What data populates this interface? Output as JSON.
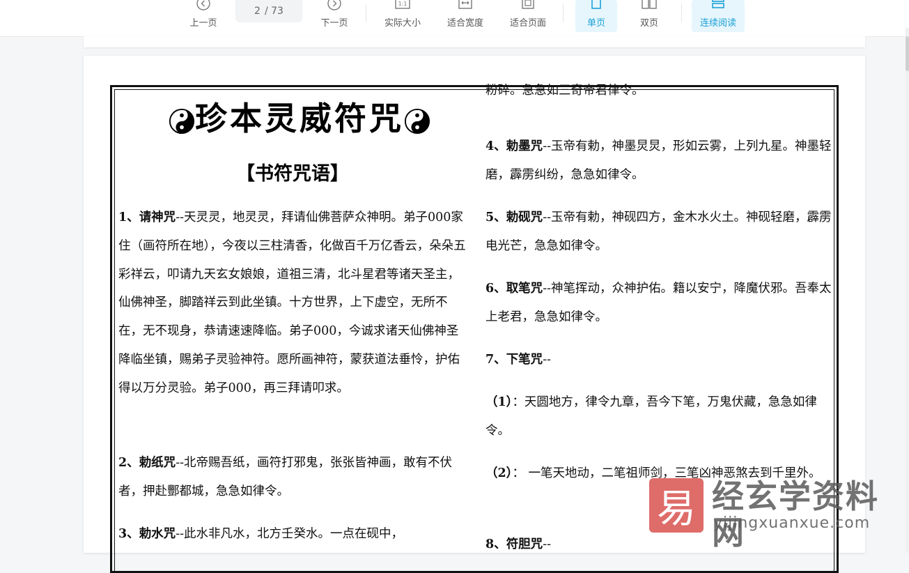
{
  "toolbar": {
    "prev_label": "上一页",
    "page_current": "2",
    "page_total": "/ 73",
    "next_label": "下一页",
    "actual_size_label": "实际大小",
    "fit_width_label": "适合宽度",
    "fit_page_label": "适合页面",
    "single_page_label": "单页",
    "double_page_label": "双页",
    "continuous_label": "连续阅读",
    "accent_color": "#1da1d8"
  },
  "document": {
    "title": "珍本灵威符咒",
    "subtitle": "【书符咒语】",
    "left_paragraphs": [
      {
        "num": "1、",
        "name": "请神咒",
        "text": "--天灵灵，地灵灵，拜请仙佛菩萨众神明。弟子000家住（画符所在地），今夜以三柱清香，化做百千万亿香云，朵朵五彩祥云，叩请九天玄女娘娘，道祖三清，北斗星君等诸天圣主，仙佛神圣，脚踏祥云到此坐镇。十方世界，上下虚空，无所不在，无不现身，恭请速速降临。弟子000，今诚求诸天仙佛神圣降临坐镇，赐弟子灵验神符。愿所画神符，蒙获道法垂怜，护佑得以万分灵验。弟子000，再三拜请叩求。"
      },
      {
        "num": "2、",
        "name": "勅纸咒",
        "text": "--北帝赐吾纸，画符打邪鬼，张张皆神画，敢有不伏者，押赴酆都城，急急如律令。"
      },
      {
        "num": "3、",
        "name": "勅水咒",
        "text": "--此水非凡水，北方壬癸水。一点在砚中，"
      }
    ],
    "right_paragraphs": [
      {
        "num": "",
        "name": "",
        "text": "粉碎。急急如三奇帝君律令。"
      },
      {
        "num": "4、",
        "name": "勅墨咒",
        "text": "--玉帝有勅，神墨炅炅，形如云雾，上列九星。神墨轻磨，霹雳纠纷，急急如律令。"
      },
      {
        "num": "5、",
        "name": "勅砚咒",
        "text": "--玉帝有勅，神砚四方，金木水火土。神砚轻磨，霹雳电光芒，急急如律令。"
      },
      {
        "num": "6、",
        "name": "取笔咒",
        "text": "--神笔挥动，众神护佑。籍以安宁，降魔伏邪。吾奉太上老君，急急如律令。"
      },
      {
        "num": "7、",
        "name": "下笔咒",
        "text": "--"
      },
      {
        "num": "（1）",
        "name": "",
        "text": "：天圆地方，律令九章，吾今下笔，万鬼伏藏，急急如律令。"
      },
      {
        "num": "（2）",
        "name": "",
        "text": "： 一笔天地动，二笔祖师剑，三笔凶神恶煞去到千里外。"
      },
      {
        "num": "8、",
        "name": "符胆咒",
        "text": "--"
      }
    ]
  },
  "watermark": {
    "logo_char": "易",
    "site_name": "经玄学资料网",
    "url": "yijingxuanxue.com",
    "logo_color": "#d9534f"
  }
}
